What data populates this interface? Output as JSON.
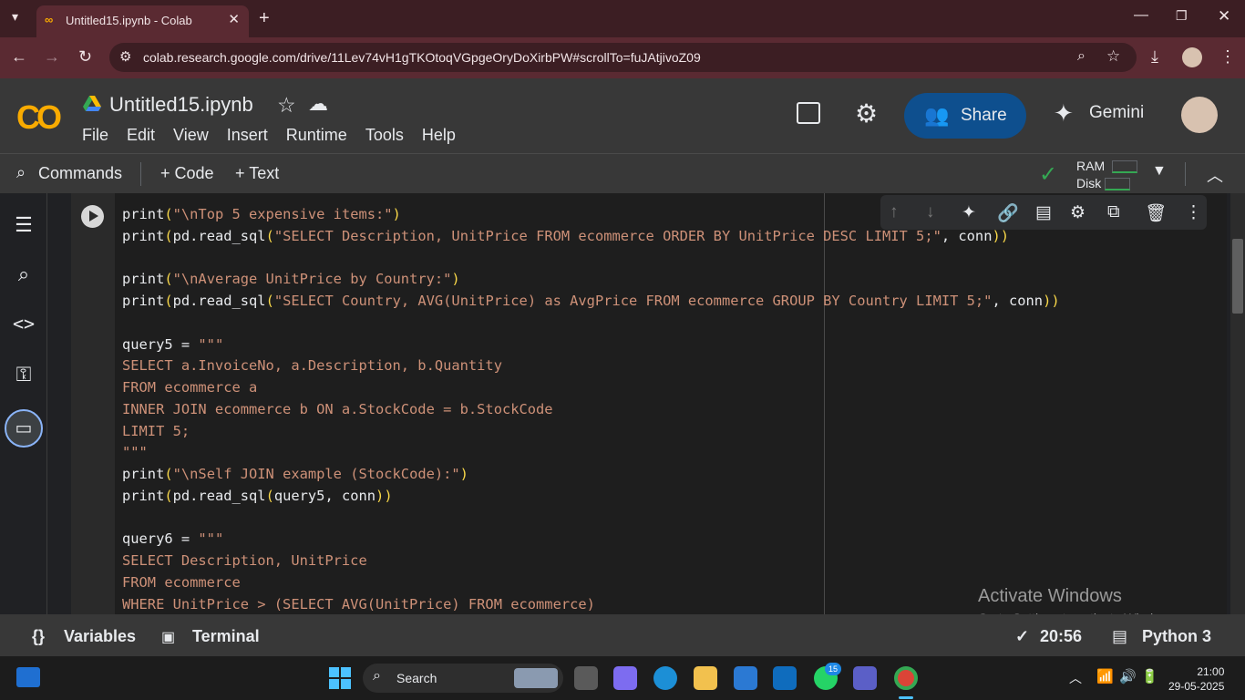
{
  "browser": {
    "tab_title": "Untitled15.ipynb - Colab",
    "url": "colab.research.google.com/drive/11Lev74vH1gTKOtoqVGpgeOryDoXirbPW#scrollTo=fuJAtjivoZ09"
  },
  "colab": {
    "logo": "CO",
    "notebook_title": "Untitled15.ipynb",
    "menu": [
      "File",
      "Edit",
      "View",
      "Insert",
      "Runtime",
      "Tools",
      "Help"
    ],
    "share_label": "Share",
    "gemini_label": "Gemini"
  },
  "commands_bar": {
    "commands_label": "Commands",
    "code_label": "+ Code",
    "text_label": "+ Text",
    "ram_label": "RAM",
    "disk_label": "Disk"
  },
  "code_lines": [
    [
      [
        "fn",
        "print"
      ],
      [
        "pn",
        "("
      ],
      [
        "str",
        "\"\\nTop 5 expensive items:\""
      ],
      [
        "pn",
        ")"
      ]
    ],
    [
      [
        "fn",
        "print"
      ],
      [
        "pn",
        "("
      ],
      [
        "fn",
        "pd.read_sql"
      ],
      [
        "pn",
        "("
      ],
      [
        "str",
        "\"SELECT Description, UnitPrice FROM ecommerce ORDER BY UnitPrice DESC LIMIT 5;\""
      ],
      [
        "fn",
        ", conn"
      ],
      [
        "pn",
        "))"
      ]
    ],
    [],
    [
      [
        "fn",
        "print"
      ],
      [
        "pn",
        "("
      ],
      [
        "str",
        "\"\\nAverage UnitPrice by Country:\""
      ],
      [
        "pn",
        ")"
      ]
    ],
    [
      [
        "fn",
        "print"
      ],
      [
        "pn",
        "("
      ],
      [
        "fn",
        "pd.read_sql"
      ],
      [
        "pn",
        "("
      ],
      [
        "str",
        "\"SELECT Country, AVG(UnitPrice) as AvgPrice FROM ecommerce GROUP BY Country LIMIT 5;\""
      ],
      [
        "fn",
        ", conn"
      ],
      [
        "pn",
        "))"
      ]
    ],
    [],
    [
      [
        "fn",
        "query5 = "
      ],
      [
        "str",
        "\"\"\""
      ]
    ],
    [
      [
        "str",
        "SELECT a.InvoiceNo, a.Description, b.Quantity"
      ]
    ],
    [
      [
        "str",
        "FROM ecommerce a"
      ]
    ],
    [
      [
        "str",
        "INNER JOIN ecommerce b ON a.StockCode = b.StockCode"
      ]
    ],
    [
      [
        "str",
        "LIMIT 5;"
      ]
    ],
    [
      [
        "str",
        "\"\"\""
      ]
    ],
    [
      [
        "fn",
        "print"
      ],
      [
        "pn",
        "("
      ],
      [
        "str",
        "\"\\nSelf JOIN example (StockCode):\""
      ],
      [
        "pn",
        ")"
      ]
    ],
    [
      [
        "fn",
        "print"
      ],
      [
        "pn",
        "("
      ],
      [
        "fn",
        "pd.read_sql"
      ],
      [
        "pn",
        "("
      ],
      [
        "fn",
        "query5, conn"
      ],
      [
        "pn",
        "))"
      ]
    ],
    [],
    [
      [
        "fn",
        "query6 = "
      ],
      [
        "str",
        "\"\"\""
      ]
    ],
    [
      [
        "str",
        "SELECT Description, UnitPrice"
      ]
    ],
    [
      [
        "str",
        "FROM ecommerce"
      ]
    ],
    [
      [
        "str",
        "WHERE UnitPrice > (SELECT AVG(UnitPrice) FROM ecommerce)"
      ]
    ]
  ],
  "status_bar": {
    "variables_label": "Variables",
    "terminal_label": "Terminal",
    "time": "20:56",
    "runtime": "Python 3"
  },
  "watermark": {
    "line1": "Activate Windows",
    "line2": "Go to Settings to activate Windows."
  },
  "taskbar": {
    "search_label": "Search",
    "whatsapp_badge": "15",
    "clock_time": "21:00",
    "clock_date": "29-05-2025"
  },
  "colors": {
    "tabstrip": "#3c1e23",
    "toolbar": "#5a2a32",
    "colab_bg": "#383838",
    "share": "#0e4f8e",
    "string": "#ce9178",
    "paren": "#f9d849",
    "ok_green": "#34a853"
  }
}
